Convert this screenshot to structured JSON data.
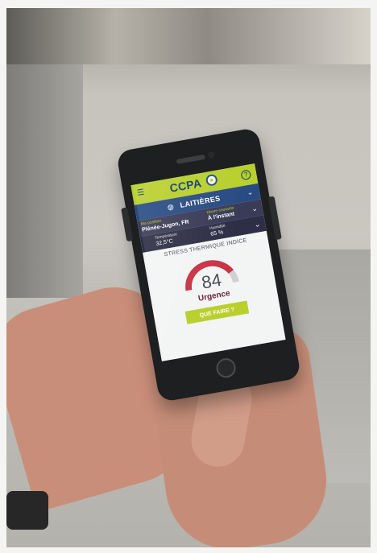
{
  "app": {
    "brand": "CCPA",
    "section": "LAITIÈRES",
    "location_label": "Ma position",
    "location_value": "Plénée-Jugon, FR",
    "timing_label": "Heure courante",
    "timing_value": "À l'instant",
    "temperature_label": "Température",
    "temperature_value": "32,5°C",
    "humidity_label": "Humidité",
    "humidity_value": "65 %",
    "stress_title": "STRESS THERMIQUE INDICE",
    "gauge_value": "84",
    "gauge_status": "Urgence",
    "action_button": "QUE FAIRE ?"
  },
  "colors": {
    "header": "#b8cf2c",
    "section": "#294b83",
    "location": "#3a3b57",
    "weather": "#2e2e46",
    "gauge_red": "#c93445",
    "gauge_track": "#cfd1d3",
    "accent_green": "#b8cf2c"
  },
  "icons": {
    "menu": "menu-icon",
    "help": "help-icon",
    "section": "cow-icon",
    "location_chevron": "chevron-down-icon",
    "weather_chevron": "chevron-down-icon",
    "section_chevron": "chevron-down-icon"
  },
  "gauge": {
    "value": 84,
    "max": 100
  }
}
